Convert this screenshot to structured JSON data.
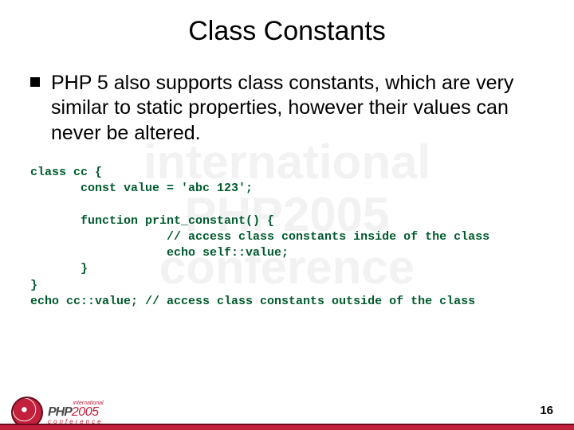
{
  "watermark": "international\nPHP2005\nconference",
  "title": "Class Constants",
  "bullet": "PHP 5 also supports class constants, which are very similar to static properties, however their values can never be altered.",
  "code": "class cc {\n       const value = 'abc 123';\n\n       function print_constant() {\n                   // access class constants inside of the class\n                   echo self::value;\n       }\n}\necho cc::value; // access class constants outside of the class",
  "logo": {
    "line1": "international",
    "php": "PHP",
    "year": "2005",
    "line3": "conference"
  },
  "page_number": "16"
}
